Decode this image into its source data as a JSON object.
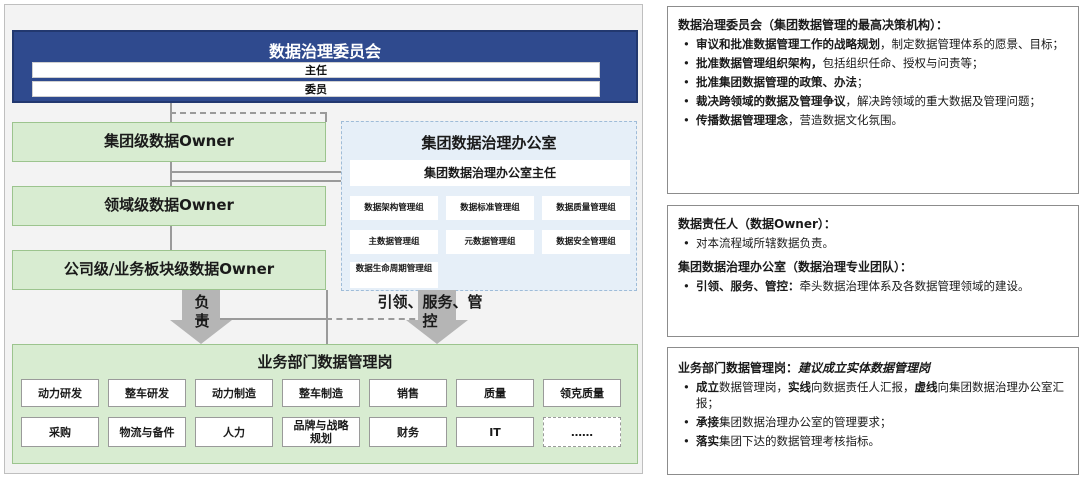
{
  "diagram": {
    "committee": {
      "title": "数据治理委员会",
      "row1": "主任",
      "row2": "委员"
    },
    "owners": [
      "集团级数据Owner",
      "领域级数据Owner",
      "公司级/业务板块级数据Owner"
    ],
    "office": {
      "title": "集团数据治理办公室",
      "head": "集团数据治理办公室主任",
      "groups": [
        "数据架构管理组",
        "数据标准管理组",
        "数据质量管理组",
        "主数据管理组",
        "元数据管理组",
        "数据安全管理组",
        "数据生命周期管理组"
      ]
    },
    "arrow_left_label": "负\n责",
    "arrow_right_label": "引领、服务、管\n控",
    "business": {
      "title": "业务部门数据管理岗",
      "row1": [
        "动力研发",
        "整车研发",
        "动力制造",
        "整车制造",
        "销售",
        "质量",
        "领克质量"
      ],
      "row2": [
        "采购",
        "物流与备件",
        "人力",
        "品牌与战略规划",
        "财务",
        "IT",
        "……"
      ]
    }
  },
  "panels": {
    "committee": {
      "title": "数据治理委员会（集团数据管理的最高决策机构）：",
      "items": [
        {
          "bold": "审议和批准数据管理工作的战略规划",
          "rest": "，制定数据管理体系的愿景、目标；"
        },
        {
          "bold": "批准数据管理组织架构，",
          "rest": "包括组织任命、授权与问责等；"
        },
        {
          "bold": "批准集团数据管理的政策、办法",
          "rest": "；"
        },
        {
          "bold": "裁决跨领域的数据及管理争议",
          "rest": "，解决跨领域的重大数据及管理问题；"
        },
        {
          "bold": "传播数据管理理念",
          "rest": "，营造数据文化氛围。"
        }
      ]
    },
    "owner": {
      "title": "数据责任人（数据Owner）：",
      "item": "对本流程域所辖数据负责。",
      "office_title": "集团数据治理办公室（数据治理专业团队）：",
      "office_item_bold": "引领、服务、管控：",
      "office_item_rest": "牵头数据治理体系及各数据管理领域的建设。"
    },
    "business": {
      "title_bold": "业务部门数据管理岗：",
      "title_italic": "建议成立实体数据管理岗",
      "item1_a": "成立",
      "item1_b": "数据管理岗，",
      "item1_c": "实线",
      "item1_d": "向数据责任人汇报，",
      "item1_e": "虚线",
      "item1_f": "向集团数据治理办公室汇报；",
      "item2_bold": "承接",
      "item2_rest": "集团数据治理办公室的管理要求；",
      "item3_bold": "落实",
      "item3_rest": "集团下达的数据管理考核指标。"
    }
  },
  "colors": {
    "committee_blue": "#2f4a8e",
    "green_fill": "#d8ecd1",
    "office_fill": "#e6eff8",
    "connector_gray": "#9a9a9a"
  }
}
